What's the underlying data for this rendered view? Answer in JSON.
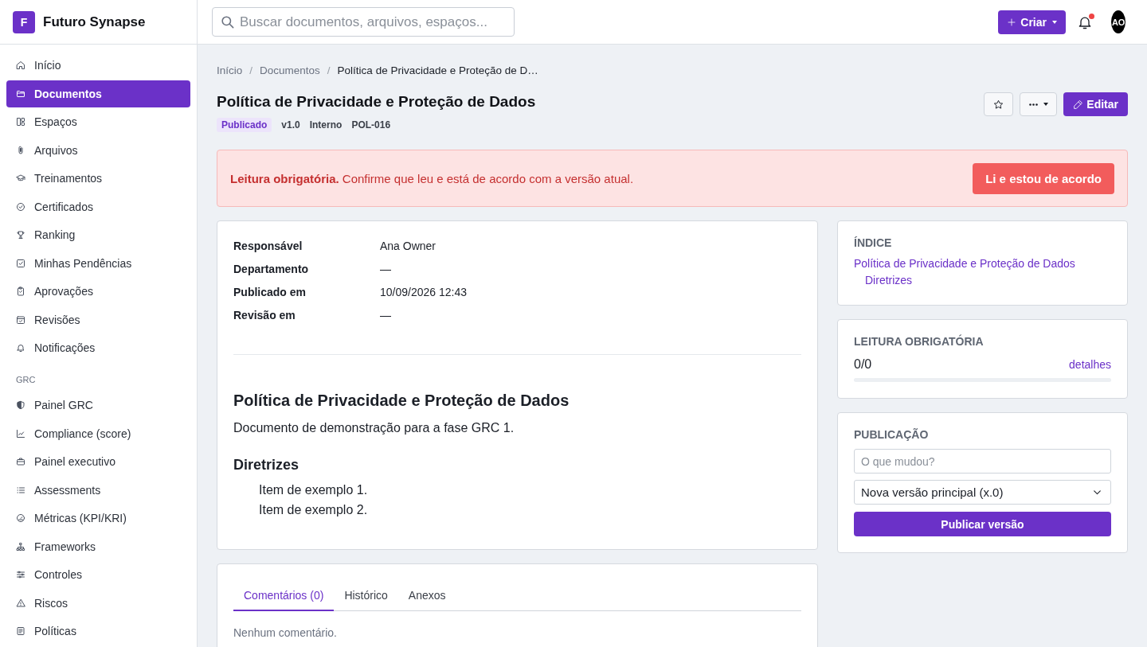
{
  "brand": {
    "logo_letter": "F",
    "name": "Futuro Synapse"
  },
  "sidebar": {
    "groups": [
      {
        "items": [
          {
            "label": "Início",
            "selected": false
          },
          {
            "label": "Documentos",
            "selected": true
          },
          {
            "label": "Espaços",
            "selected": false
          },
          {
            "label": "Arquivos",
            "selected": false
          },
          {
            "label": "Treinamentos",
            "selected": false
          },
          {
            "label": "Certificados",
            "selected": false
          },
          {
            "label": "Ranking",
            "selected": false
          },
          {
            "label": "Minhas Pendências",
            "selected": false
          },
          {
            "label": "Aprovações",
            "selected": false
          },
          {
            "label": "Revisões",
            "selected": false
          },
          {
            "label": "Notificações",
            "selected": false
          }
        ]
      },
      {
        "heading": "GRC",
        "items": [
          {
            "label": "Painel GRC",
            "selected": false
          },
          {
            "label": "Compliance (score)",
            "selected": false
          },
          {
            "label": "Painel executivo",
            "selected": false
          },
          {
            "label": "Assessments",
            "selected": false
          },
          {
            "label": "Métricas (KPI/KRI)",
            "selected": false
          },
          {
            "label": "Frameworks",
            "selected": false
          },
          {
            "label": "Controles",
            "selected": false
          },
          {
            "label": "Riscos",
            "selected": false
          },
          {
            "label": "Políticas",
            "selected": false
          }
        ]
      }
    ]
  },
  "topbar": {
    "search": {
      "placeholder": "Buscar documentos, arquivos, espaços..."
    },
    "create_button": "Criar",
    "notifications": {
      "unread": true
    },
    "avatar": "AO"
  },
  "page": {
    "breadcrumb": {
      "separator": "/",
      "items": [
        {
          "label": "Início"
        },
        {
          "label": "Documentos"
        },
        {
          "label": "Política de Privacidade e Proteção de D…"
        }
      ]
    },
    "title": "Política de Privacidade e Proteção de Dados",
    "tags": [
      {
        "kind": "status",
        "label": "Publicado"
      },
      {
        "kind": "plain",
        "label": "v1.0"
      },
      {
        "kind": "plain",
        "label": "Interno"
      },
      {
        "kind": "plain",
        "label": "POL-016"
      }
    ],
    "actions": {
      "starred": false,
      "edit_button": "Editar"
    },
    "alert": {
      "message": "**Leitura obrigatória.** Confirme que leu e está de acordo com a versão atual.",
      "button": "Li e estou de acordo"
    },
    "details": [
      {
        "label": "Responsável",
        "value": "Ana Owner"
      },
      {
        "label": "Departamento",
        "value": "—"
      },
      {
        "label": "Publicado em",
        "value": "10/09/2026 12:43"
      },
      {
        "label": "Revisão em",
        "value": "—"
      }
    ],
    "body": [
      {
        "kind": "heading",
        "text": "Política de Privacidade e Proteção de Dados"
      },
      {
        "kind": "paragraph",
        "text": "Documento de demonstração para a fase GRC 1."
      },
      {
        "kind": "subheading",
        "text": "Diretrizes"
      },
      {
        "kind": "list",
        "items": [
          "Item de exemplo 1.",
          "Item de exemplo 2."
        ]
      }
    ],
    "tabs": [
      {
        "label": "Comentários (0)",
        "selected": true
      },
      {
        "label": "Histórico",
        "selected": false
      },
      {
        "label": "Anexos",
        "selected": false
      }
    ],
    "empty_message": "Nenhum comentário.",
    "index": {
      "title": "ÍNDICE",
      "entries": [
        {
          "label": "Política de Privacidade e Proteção de Dados",
          "children": [
            {
              "label": "Diretrizes"
            }
          ]
        }
      ]
    },
    "reading": {
      "title": "LEITURA OBRIGATÓRIA",
      "count": "0/0",
      "link": "detalhes"
    },
    "publication": {
      "title": "PUBLICAÇÃO",
      "note_field": {
        "placeholder": "O que mudou?"
      },
      "version_select": {
        "value": "Nova versão principal (x.0)"
      },
      "publish_button": "Publicar versão"
    }
  }
}
